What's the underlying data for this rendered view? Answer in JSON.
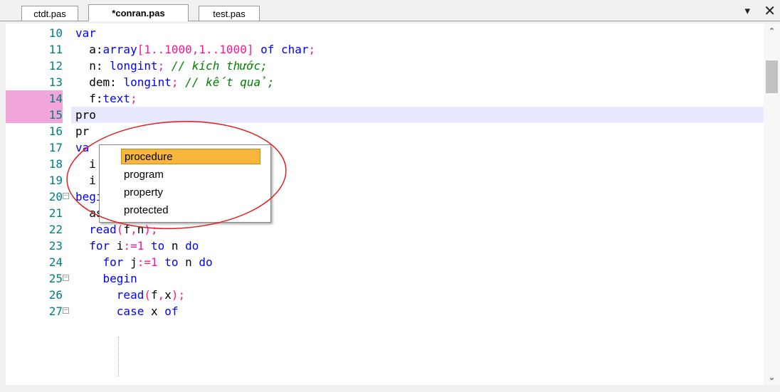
{
  "tabs": [
    {
      "label": "ctdt.pas",
      "active": false
    },
    {
      "label": "*conran.pas",
      "active": true
    },
    {
      "label": "test.pas",
      "active": false
    }
  ],
  "window_controls": {
    "menu_icon": "▾",
    "close_icon": "✕"
  },
  "code_lines": [
    {
      "number": "10",
      "text": "var"
    },
    {
      "number": "11",
      "text": "  a:array[1..1000,1..1000] of char;"
    },
    {
      "number": "12",
      "text": "  n: longint; // kích thước;"
    },
    {
      "number": "13",
      "text": "  dem: longint; // kết quả;"
    },
    {
      "number": "14",
      "text": "  f:text;"
    },
    {
      "number": "15",
      "text": "pro"
    },
    {
      "number": "16",
      "text": "pr"
    },
    {
      "number": "17",
      "text": "va"
    },
    {
      "number": "18",
      "text": "  i"
    },
    {
      "number": "19",
      "text": "  i        g  ;"
    },
    {
      "number": "20",
      "text": "begin"
    },
    {
      "number": "21",
      "text": "  assign(f,fi); reset(f);"
    },
    {
      "number": "22",
      "text": "  read(f,n);"
    },
    {
      "number": "23",
      "text": "  for i:=1 to n do"
    },
    {
      "number": "24",
      "text": "    for j:=1 to n do"
    },
    {
      "number": "25",
      "text": "    begin"
    },
    {
      "number": "26",
      "text": "      read(f,x);"
    },
    {
      "number": "27",
      "text": "      case x of"
    }
  ],
  "autocomplete": {
    "items": [
      "procedure",
      "program",
      "property",
      "protected"
    ],
    "selected": "procedure"
  },
  "colors": {
    "keyword": "#0000ff",
    "string_number": "#ff1493",
    "comment": "#008000",
    "line_number": "#008080",
    "breakpoint": "#f0a6d8",
    "selection": "#f8b63a",
    "annotation": "#e02020"
  }
}
